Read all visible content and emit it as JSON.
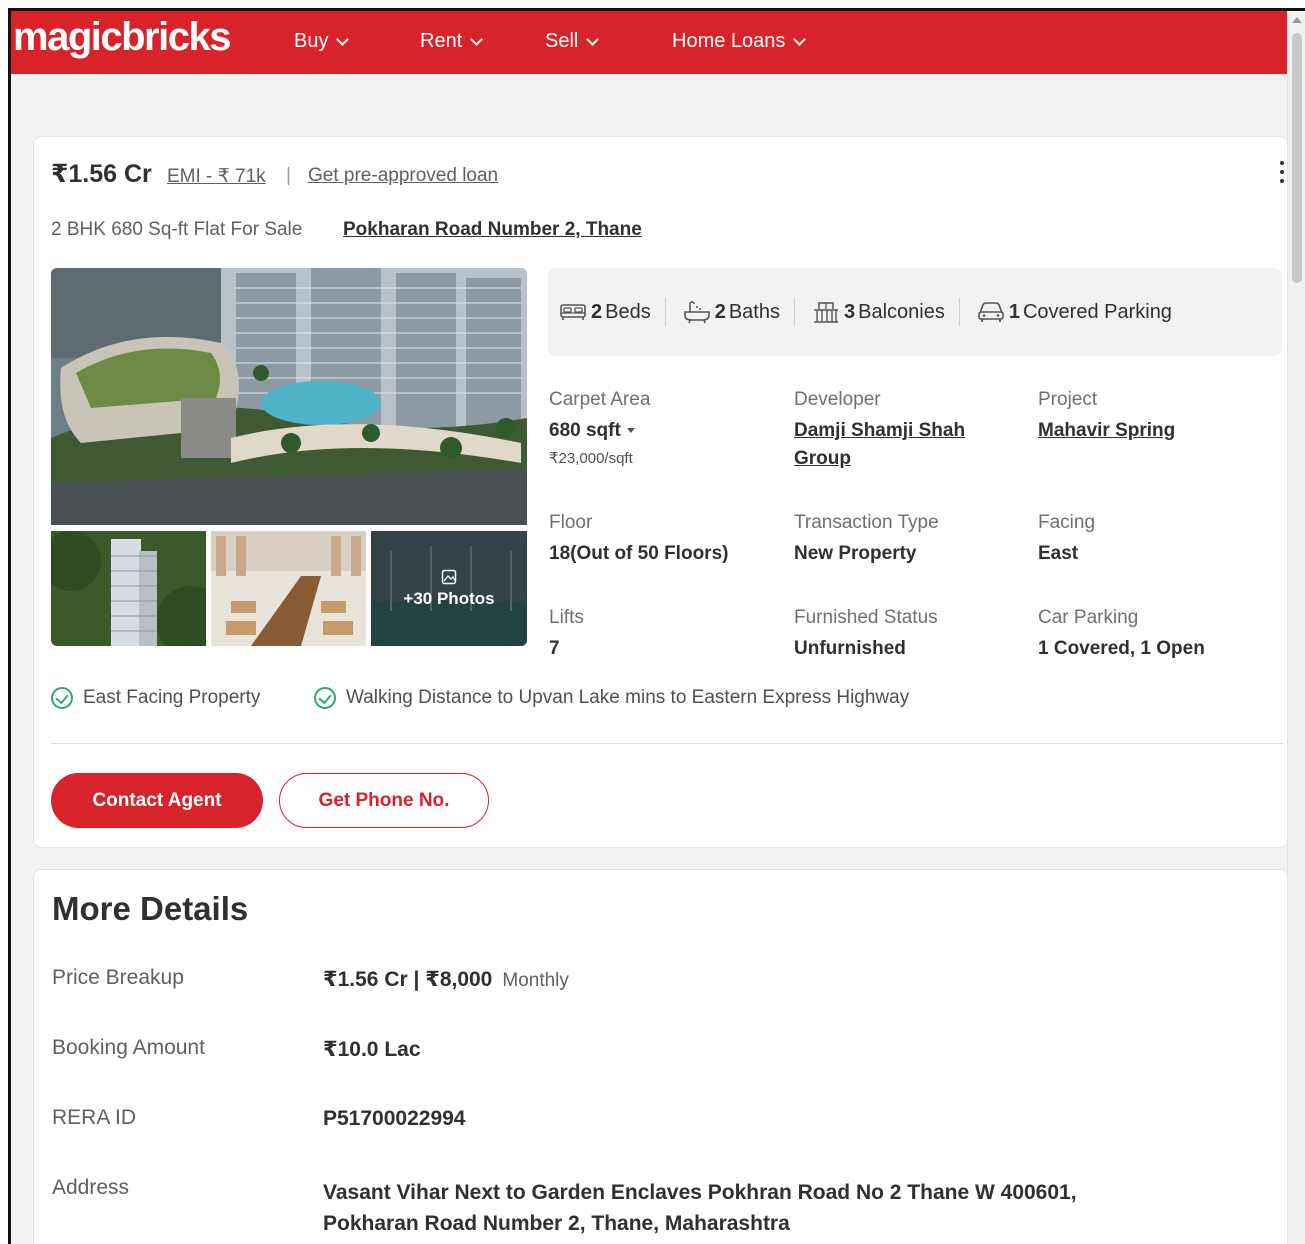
{
  "header": {
    "logo": "magicbricks",
    "nav": [
      {
        "label": "Buy"
      },
      {
        "label": "Rent"
      },
      {
        "label": "Sell"
      },
      {
        "label": "Home Loans"
      }
    ]
  },
  "listing": {
    "price": "₹1.56 Cr",
    "emi": "EMI - ₹ 71k",
    "separator": "|",
    "loan_link": "Get pre-approved loan",
    "subtitle": "2 BHK 680 Sq-ft Flat For Sale",
    "locality": "Pokharan Road Number 2, Thane",
    "photos_more": "+30 Photos",
    "summary": {
      "beds_num": "2",
      "beds_label": "Beds",
      "baths_num": "2",
      "baths_label": "Baths",
      "balconies_num": "3",
      "balconies_label": "Balconies",
      "parking_num": "1",
      "parking_label": "Covered Parking"
    },
    "facts": {
      "carpet_label": "Carpet Area",
      "carpet_value": "680 sqft",
      "carpet_rate": "₹23,000/sqft",
      "developer_label": "Developer",
      "developer_line1": "Damji Shamji Shah",
      "developer_line2": "Group",
      "project_label": "Project",
      "project_value": "Mahavir Spring",
      "floor_label": "Floor",
      "floor_value": "18(Out of 50 Floors)",
      "transaction_label": "Transaction Type",
      "transaction_value": "New Property",
      "facing_label": "Facing",
      "facing_value": "East",
      "lifts_label": "Lifts",
      "lifts_value": "7",
      "furnished_label": "Furnished Status",
      "furnished_value": "Unfurnished",
      "car_parking_label": "Car Parking",
      "car_parking_value": "1 Covered, 1 Open"
    },
    "highlights": [
      "East Facing Property",
      "Walking Distance to Upvan Lake mins to Eastern Express Highway"
    ],
    "contact_button": "Contact Agent",
    "phone_button": "Get Phone No."
  },
  "more_details": {
    "title": "More Details",
    "price_breakup_label": "Price Breakup",
    "price_breakup_value": "₹1.56 Cr | ₹8,000",
    "price_breakup_unit": "Monthly",
    "booking_label": "Booking Amount",
    "booking_value": "₹10.0 Lac",
    "rera_label": "RERA ID",
    "rera_value": "P51700022994",
    "address_label": "Address",
    "address_line1": "Vasant Vihar Next to Garden Enclaves Pokhran Road No 2 Thane W 400601,",
    "address_line2": "Pokharan Road Number 2, Thane, Maharashtra"
  },
  "colors": {
    "brand_red": "#d8232a",
    "check_green": "#2faa6b"
  }
}
